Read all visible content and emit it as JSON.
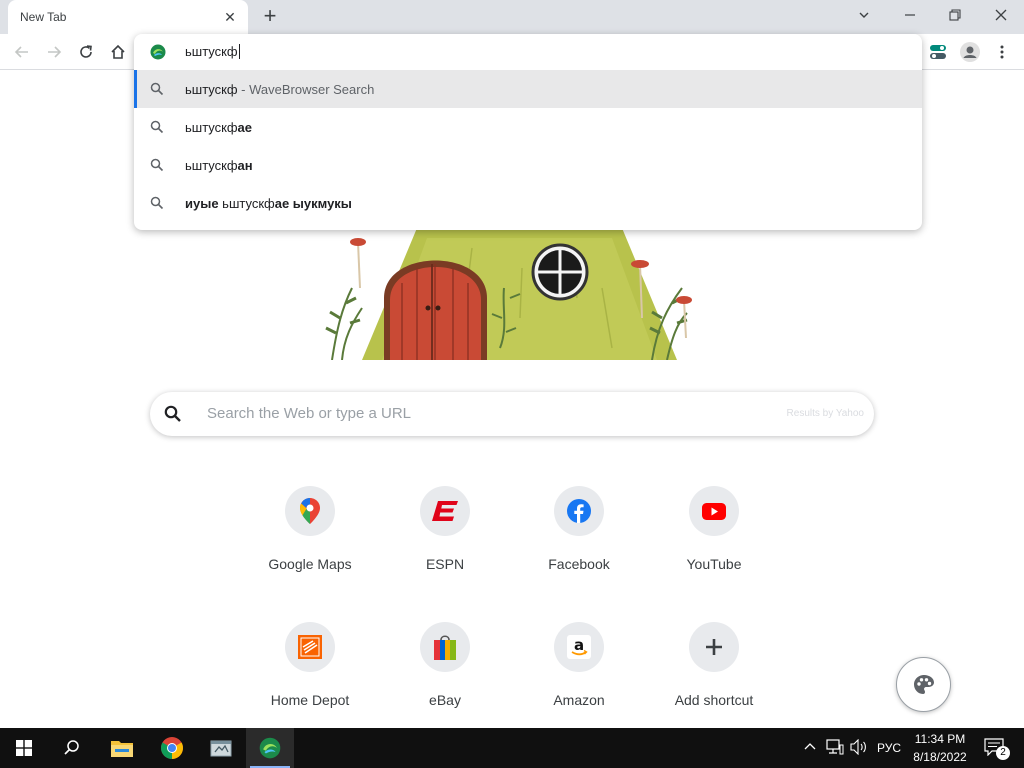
{
  "tab": {
    "title": "New Tab"
  },
  "omnibox": {
    "typed": "ьштускф",
    "suggestions": [
      {
        "plain": "ьштускф",
        "bold": "",
        "meta": " - WaveBrowser Search"
      },
      {
        "plain": "ьштускф",
        "bold": "ае",
        "meta": ""
      },
      {
        "plain": "ьштускф",
        "bold": "ан",
        "meta": ""
      },
      {
        "bold_prefix": "иуые ",
        "plain": "ьштускф",
        "bold": "ае ыукмукы",
        "meta": ""
      }
    ]
  },
  "search": {
    "placeholder": "Search the Web or type a URL",
    "powered_by": "Results by Yahoo"
  },
  "shortcuts": [
    {
      "label": "Google Maps",
      "icon": "google-maps-icon"
    },
    {
      "label": "ESPN",
      "icon": "espn-icon"
    },
    {
      "label": "Facebook",
      "icon": "facebook-icon"
    },
    {
      "label": "YouTube",
      "icon": "youtube-icon"
    },
    {
      "label": "Home Depot",
      "icon": "home-depot-icon"
    },
    {
      "label": "eBay",
      "icon": "ebay-icon"
    },
    {
      "label": "Amazon",
      "icon": "amazon-icon"
    },
    {
      "label": "Add shortcut",
      "icon": "plus-icon"
    }
  ],
  "taskbar": {
    "language": "РУС",
    "time": "11:34 PM",
    "date": "8/18/2022",
    "notifications": "2"
  },
  "colors": {
    "accent": "#1a73e8",
    "tabstrip": "#dee1e6",
    "taskbar": "#101010"
  }
}
